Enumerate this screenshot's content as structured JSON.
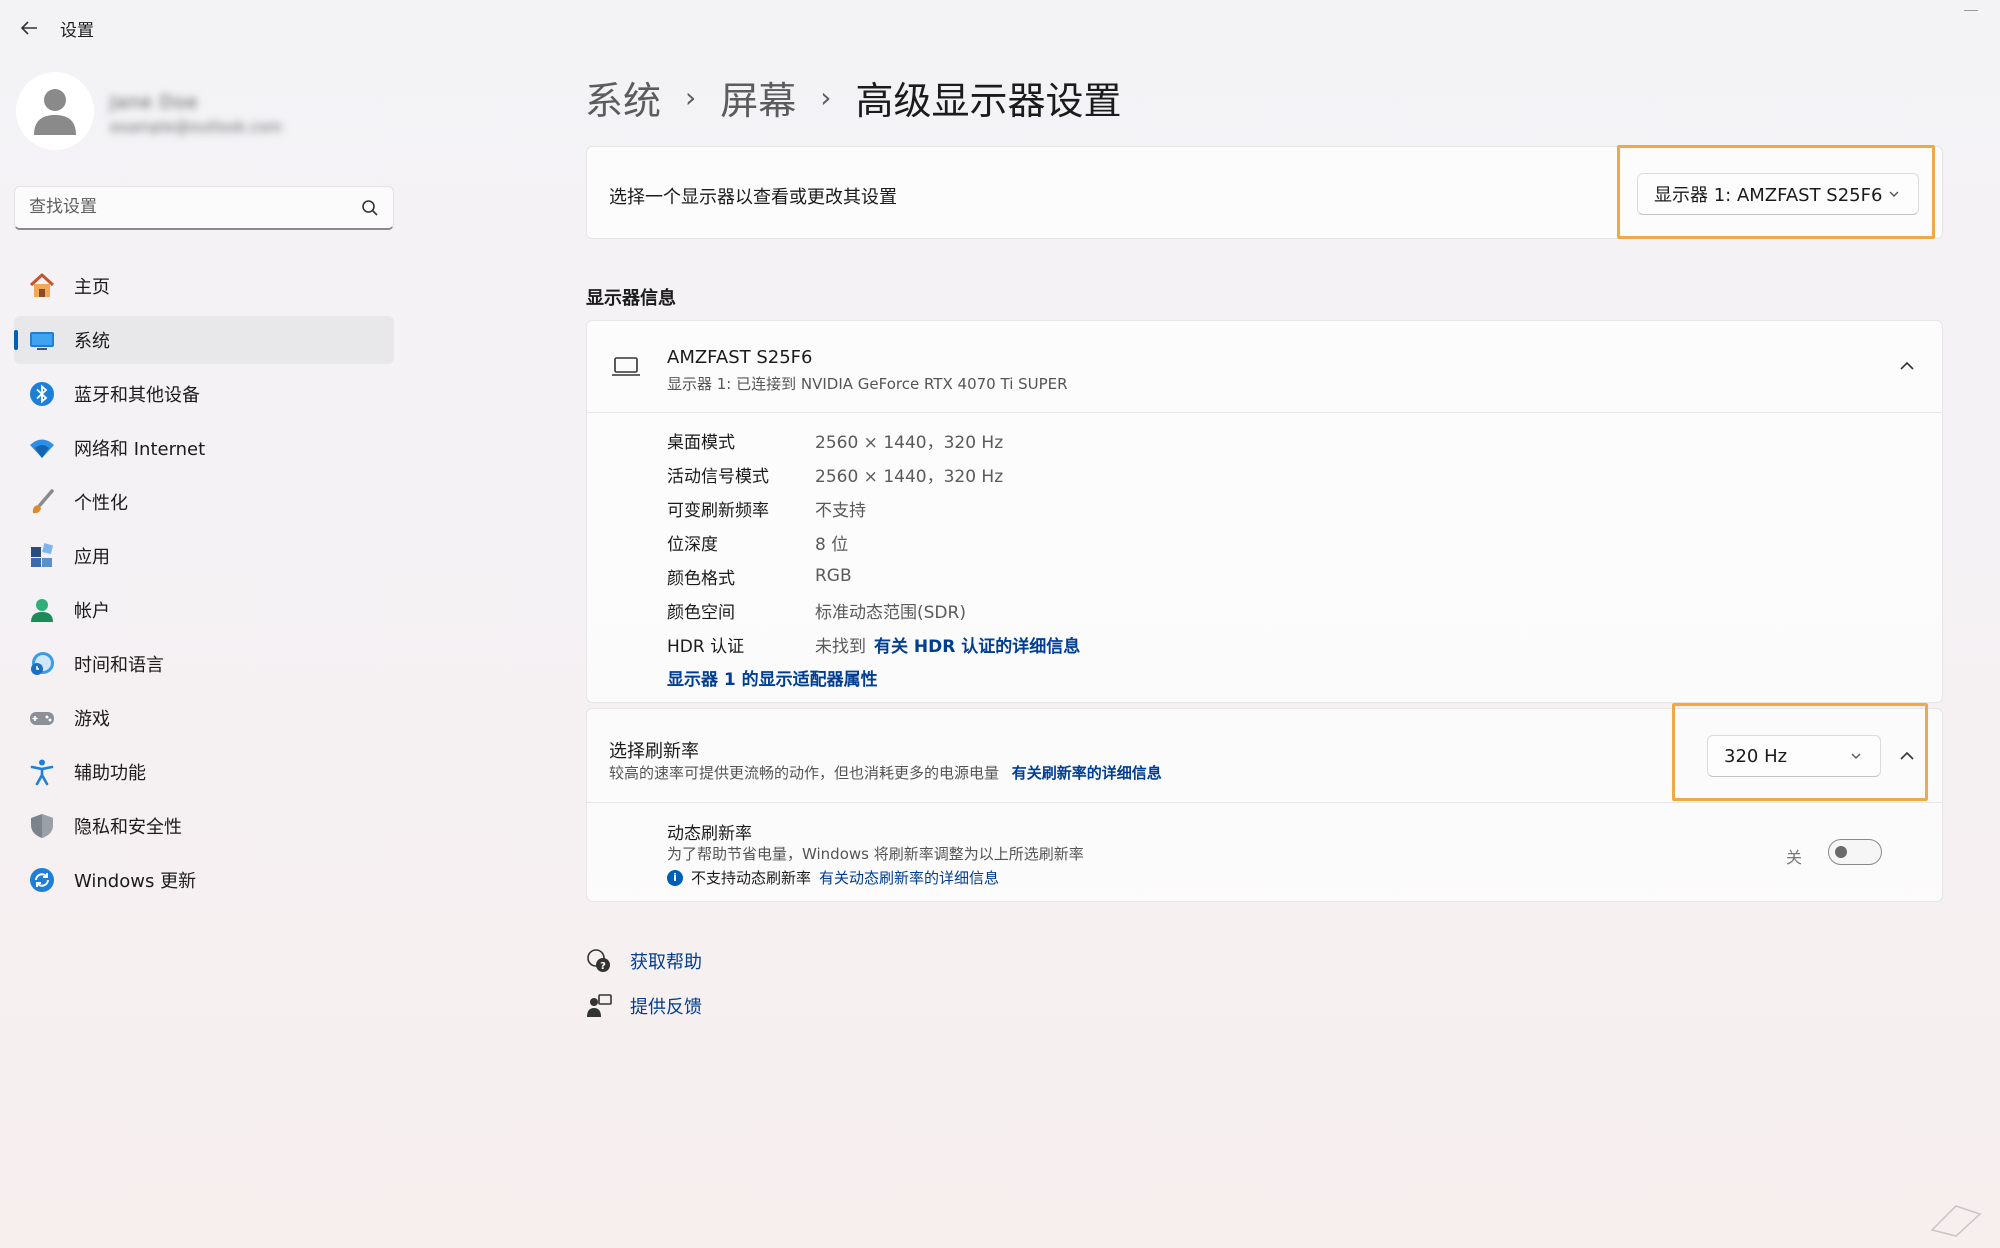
{
  "window": {
    "title": "设置"
  },
  "profile": {
    "name": "Jane Doe",
    "email": "example@outlook.com"
  },
  "search": {
    "placeholder": "查找设置"
  },
  "sidebar": {
    "items": [
      {
        "label": "主页",
        "icon": "home-icon"
      },
      {
        "label": "系统",
        "icon": "system-display-icon",
        "active": true
      },
      {
        "label": "蓝牙和其他设备",
        "icon": "bluetooth-icon"
      },
      {
        "label": "网络和 Internet",
        "icon": "wifi-icon"
      },
      {
        "label": "个性化",
        "icon": "paintbrush-icon"
      },
      {
        "label": "应用",
        "icon": "apps-icon"
      },
      {
        "label": "帐户",
        "icon": "account-icon"
      },
      {
        "label": "时间和语言",
        "icon": "time-language-icon"
      },
      {
        "label": "游戏",
        "icon": "gamepad-icon"
      },
      {
        "label": "辅助功能",
        "icon": "accessibility-icon"
      },
      {
        "label": "隐私和安全性",
        "icon": "shield-icon"
      },
      {
        "label": "Windows 更新",
        "icon": "update-icon"
      }
    ]
  },
  "breadcrumb": {
    "items": [
      "系统",
      "屏幕",
      "高级显示器设置"
    ]
  },
  "display_select": {
    "label": "选择一个显示器以查看或更改其设置",
    "value": "显示器 1: AMZFAST S25F6"
  },
  "display_info": {
    "section_title": "显示器信息",
    "monitor_name": "AMZFAST S25F6",
    "monitor_subtitle": "显示器 1: 已连接到 NVIDIA GeForce RTX 4070 Ti SUPER",
    "specs": [
      {
        "key": "桌面模式",
        "value": "2560 × 1440，320 Hz"
      },
      {
        "key": "活动信号模式",
        "value": "2560 × 1440，320 Hz"
      },
      {
        "key": "可变刷新频率",
        "value": "不支持"
      },
      {
        "key": "位深度",
        "value": "8 位"
      },
      {
        "key": "颜色格式",
        "value": "RGB"
      },
      {
        "key": "颜色空间",
        "value": "标准动态范围(SDR)"
      },
      {
        "key": "HDR 认证",
        "value": "未找到",
        "link": "有关 HDR 认证的详细信息"
      }
    ],
    "adapter_link": "显示器 1 的显示适配器属性"
  },
  "refresh_rate": {
    "title": "选择刷新率",
    "subtitle": "较高的速率可提供更流畅的动作，但也消耗更多的电源电量",
    "link": "有关刷新率的详细信息",
    "value": "320 Hz",
    "dynamic": {
      "title": "动态刷新率",
      "subtitle": "为了帮助节省电量，Windows 将刷新率调整为以上所选刷新率",
      "note": "不支持动态刷新率",
      "note_link": "有关动态刷新率的详细信息",
      "toggle_label": "关",
      "toggle_on": false
    }
  },
  "help": {
    "get_help": "获取帮助",
    "feedback": "提供反馈"
  },
  "colors": {
    "accent": "#005fb8",
    "link": "#003e92",
    "highlight": "#f0a848"
  }
}
